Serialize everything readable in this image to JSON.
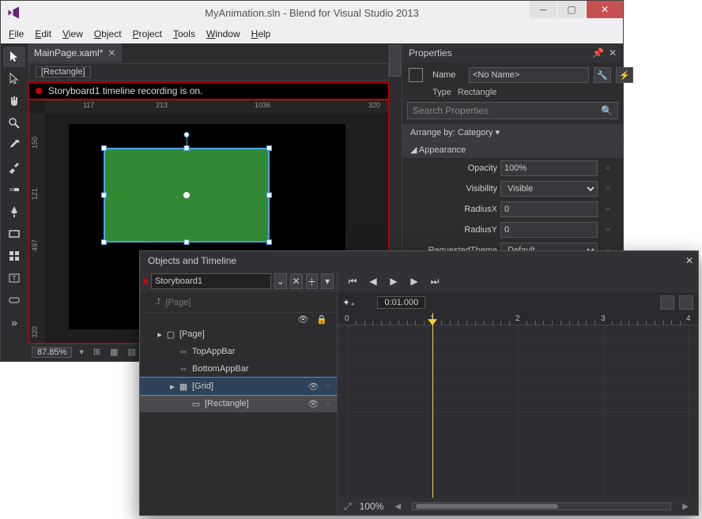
{
  "window": {
    "title": "MyAnimation.sln - Blend for Visual Studio 2013"
  },
  "menubar": [
    "File",
    "Edit",
    "View",
    "Object",
    "Project",
    "Tools",
    "Window",
    "Help"
  ],
  "tab": {
    "name": "MainPage.xaml*",
    "dirty": true
  },
  "breadcrumb": "[Rectangle]",
  "recording_banner": "Storyboard1 timeline recording is on.",
  "ruler_h": [
    "117",
    "213",
    "1036",
    "320"
  ],
  "ruler_v": [
    "150",
    "121",
    "497",
    "320"
  ],
  "zoom": {
    "value": "87.85%"
  },
  "properties": {
    "panel_title": "Properties",
    "name_label": "Name",
    "name_value": "<No Name>",
    "type_label": "Type",
    "type_value": "Rectangle",
    "search_placeholder": "Search Properties",
    "arrange_by": "Arrange by: Category",
    "cat_appearance": "Appearance",
    "fields": {
      "opacity_label": "Opacity",
      "opacity_value": "100%",
      "visibility_label": "Visibility",
      "visibility_value": "Visible",
      "radiusx_label": "RadiusX",
      "radiusx_value": "0",
      "radiusy_label": "RadiusY",
      "radiusy_value": "0",
      "reqtheme_label": "RequestedTheme",
      "reqtheme_value": "Default"
    }
  },
  "timeline": {
    "panel_title": "Objects and Timeline",
    "storyboard": "Storyboard1",
    "page_hint": "[Page]",
    "current_time": "0:01.000",
    "ruler_ticks": [
      "0",
      "1",
      "2",
      "3",
      "4"
    ],
    "tree": [
      {
        "depth": 0,
        "label": "[Page]",
        "expander": "▸",
        "icon": "▢",
        "sel": false
      },
      {
        "depth": 1,
        "label": "TopAppBar",
        "expander": "",
        "icon": "⇔",
        "sel": false
      },
      {
        "depth": 1,
        "label": "BottomAppBar",
        "expander": "",
        "icon": "⇔",
        "sel": false
      },
      {
        "depth": 1,
        "label": "[Grid]",
        "expander": "▸",
        "icon": "▦",
        "sel": true,
        "eye": true
      },
      {
        "depth": 2,
        "label": "[Rectangle]",
        "expander": "",
        "icon": "▭",
        "sel2": true,
        "eye": true
      }
    ],
    "zoom": "100%"
  }
}
